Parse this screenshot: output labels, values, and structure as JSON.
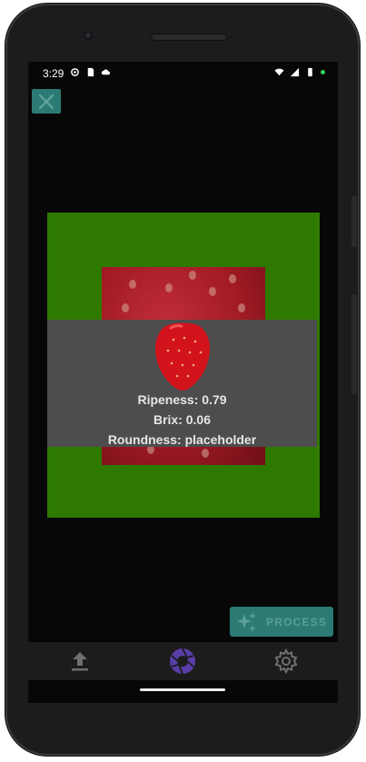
{
  "status_bar": {
    "time": "3:29"
  },
  "toolbar": {
    "close_icon": "close-icon"
  },
  "result": {
    "ripeness_label": "Ripeness: 0.79",
    "brix_label": "Brix: 0.06",
    "roundness_label": "Roundness: placeholder"
  },
  "actions": {
    "process_label": "PROCESS"
  },
  "nav": {
    "items": [
      {
        "icon": "upload-icon"
      },
      {
        "icon": "camera-shutter-icon"
      },
      {
        "icon": "gear-icon"
      }
    ]
  },
  "colors": {
    "accent_teal": "#2b7b74",
    "frame_green": "#2e7a00",
    "overlay_gray": "#4d4d4d",
    "nav_active_purple": "#5a3ea8"
  }
}
